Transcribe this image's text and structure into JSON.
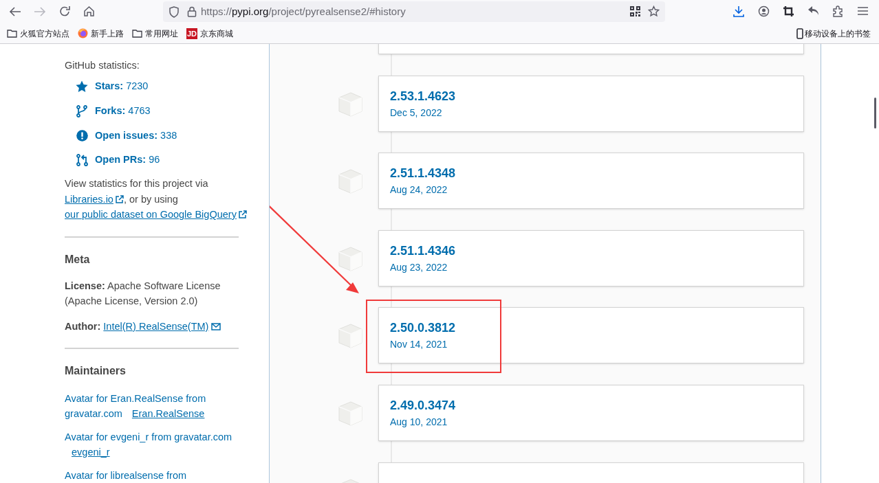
{
  "browser": {
    "url": {
      "scheme": "https://",
      "host": "pypi.org",
      "path": "/project/pyrealsense2/#history"
    },
    "bookmarks": [
      {
        "kind": "folder",
        "label": "火狐官方站点"
      },
      {
        "kind": "firefox",
        "label": "新手上路"
      },
      {
        "kind": "folder",
        "label": "常用网址"
      },
      {
        "kind": "jd",
        "label": "京东商城",
        "badge": "JD"
      }
    ],
    "mobile_bookmarks": "移动设备上的书签"
  },
  "sidebar": {
    "github_heading": "GitHub statistics:",
    "stats": [
      {
        "kind": "star",
        "label": "Stars:",
        "value": "7230"
      },
      {
        "kind": "fork",
        "label": "Forks:",
        "value": "4763"
      },
      {
        "kind": "issue",
        "label": "Open issues:",
        "value": "338"
      },
      {
        "kind": "pr",
        "label": "Open PRs:",
        "value": "96"
      }
    ],
    "statistics_note": {
      "text": "View statistics for this project via",
      "link1": "Libraries.io",
      "middle": ", or by using",
      "link2": "our public dataset on Google BigQuery"
    },
    "meta": {
      "heading": "Meta",
      "license_label": "License:",
      "license": "Apache Software License (Apache License, Version 2.0)",
      "author_label": "Author:",
      "author": "Intel(R) RealSense(TM)"
    },
    "maintainers": {
      "heading": "Maintainers",
      "items": [
        {
          "avatar_alt": "Avatar for Eran.RealSense from gravatar.com",
          "name": "Eran.RealSense"
        },
        {
          "avatar_alt": "Avatar for evgeni_r from gravatar.com",
          "name": "evgeni_r"
        },
        {
          "avatar_alt": "Avatar for librealsense from"
        }
      ]
    }
  },
  "releases": [
    {
      "version": "2.53.1.4623",
      "date": "Dec 5, 2022",
      "highlighted": false
    },
    {
      "version": "2.51.1.4348",
      "date": "Aug 24, 2022",
      "highlighted": false
    },
    {
      "version": "2.51.1.4346",
      "date": "Aug 23, 2022",
      "highlighted": false
    },
    {
      "version": "2.50.0.3812",
      "date": "Nov 14, 2021",
      "highlighted": true
    },
    {
      "version": "2.49.0.3474",
      "date": "Aug 10, 2021",
      "highlighted": false
    }
  ]
}
